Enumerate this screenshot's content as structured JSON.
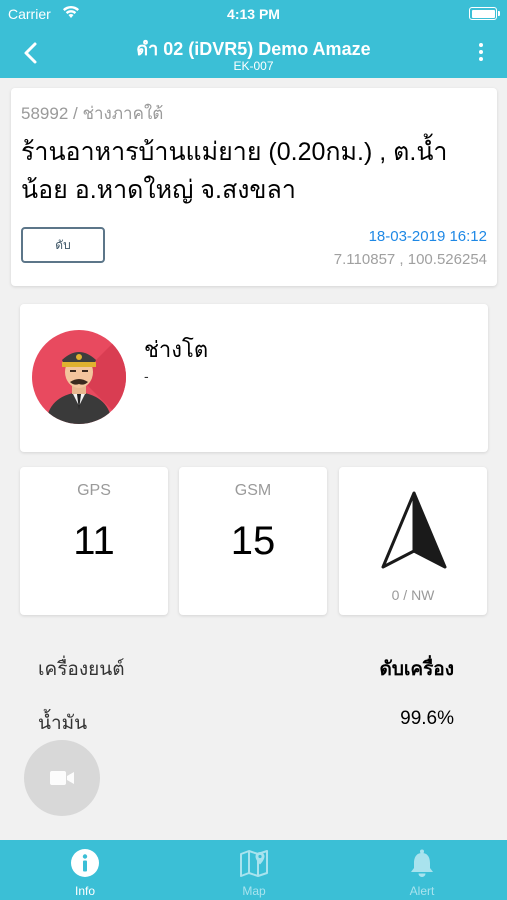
{
  "status_bar": {
    "carrier": "Carrier",
    "time": "4:13 PM"
  },
  "nav": {
    "title": "ดำ 02 (iDVR5) Demo Amaze",
    "subtitle": "EK-007"
  },
  "location": {
    "id_line": "58992 / ช่างภาคใต้",
    "address": "ร้านอาหารบ้านแม่ยาย (0.20กม.) , ต.น้ำน้อย อ.หาดใหญ่ จ.สงขลา",
    "status_button": "ดับ",
    "datetime": "18-03-2019 16:12",
    "coords": "7.110857 , 100.526254"
  },
  "driver": {
    "name": "ช่างโต",
    "detail": "-"
  },
  "stats": {
    "gps": {
      "label": "GPS",
      "value": "11"
    },
    "gsm": {
      "label": "GSM",
      "value": "15"
    },
    "direction": {
      "label": "0 / NW"
    }
  },
  "info_rows": {
    "engine": {
      "label": "เครื่องยนต์",
      "value": "ดับเครื่อง"
    },
    "fuel": {
      "label": "น้ำมัน",
      "value": "99.6%"
    }
  },
  "tabs": {
    "info": "Info",
    "map": "Map",
    "alert": "Alert"
  },
  "colors": {
    "primary": "#3bbfd6",
    "link_blue": "#1e88e5",
    "avatar_bg": "#e84a5f"
  },
  "icons": {
    "back": "chevron-left-icon",
    "menu": "more-vertical-icon",
    "compass": "navigation-arrow-icon",
    "video": "video-camera-icon",
    "info": "info-circle-icon",
    "map": "map-icon",
    "alert": "bell-icon"
  }
}
